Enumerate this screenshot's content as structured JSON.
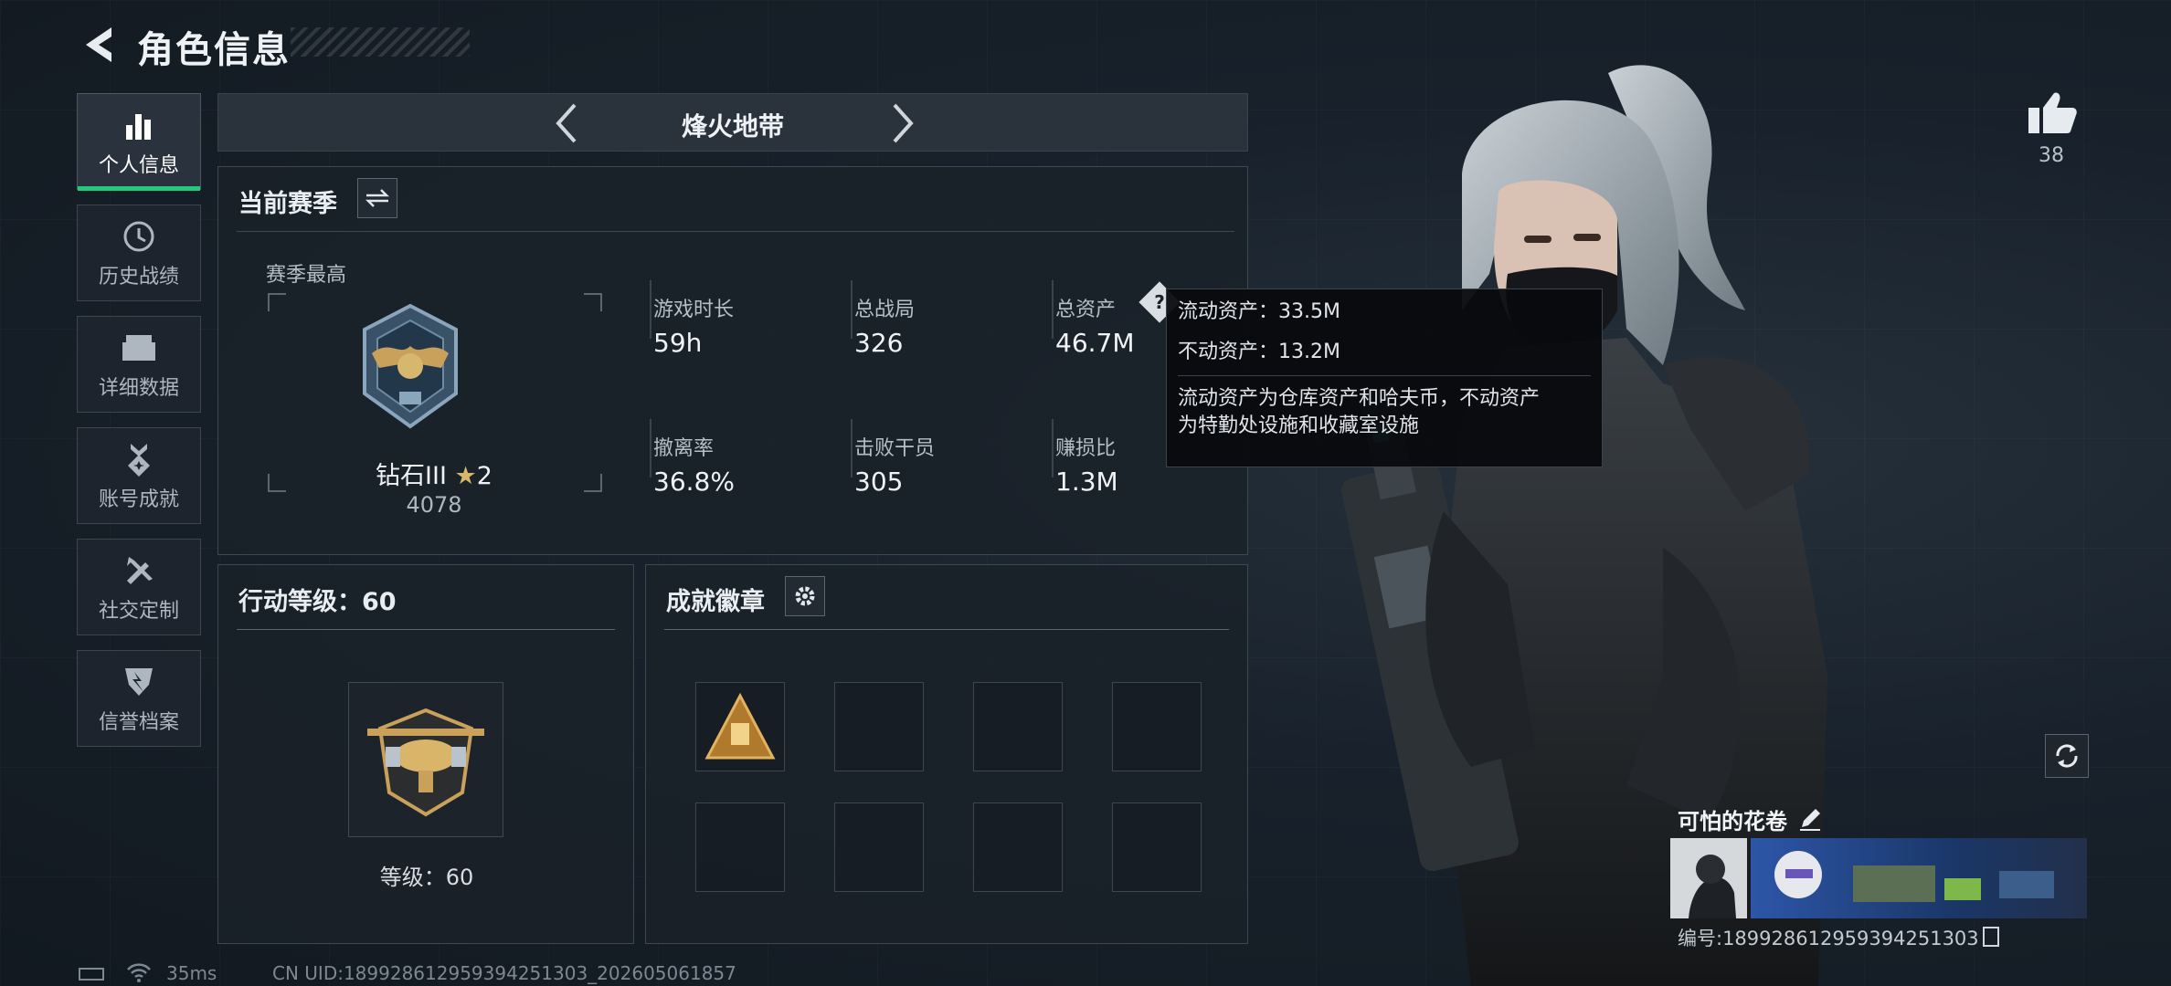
{
  "header": {
    "title": "角色信息"
  },
  "sidebar": {
    "items": [
      {
        "label": "个人信息",
        "icon": "bar-chart-icon",
        "active": true
      },
      {
        "label": "历史战绩",
        "icon": "clock-icon"
      },
      {
        "label": "详细数据",
        "icon": "folder-icon"
      },
      {
        "label": "账号成就",
        "icon": "medal-icon"
      },
      {
        "label": "社交定制",
        "icon": "tools-icon"
      },
      {
        "label": "信誉档案",
        "icon": "shield-icon"
      }
    ]
  },
  "mode": {
    "title": "烽火地带"
  },
  "season": {
    "header": "当前赛季",
    "best_label": "赛季最高",
    "rank_name": "钻石III",
    "rank_stars": "2",
    "rank_score": "4078",
    "stats": [
      {
        "label": "游戏时长",
        "value": "59h"
      },
      {
        "label": "总战局",
        "value": "326"
      },
      {
        "label": "总资产",
        "value": "46.7M"
      },
      {
        "label": "撤离率",
        "value": "36.8%"
      },
      {
        "label": "击败干员",
        "value": "305"
      },
      {
        "label": "赚损比",
        "value": "1.3M"
      }
    ]
  },
  "tooltip": {
    "liquid": "流动资产：33.5M",
    "fixed": "不动资产：13.2M",
    "desc_line1": "流动资产为仓库资产和哈夫币，不动资产",
    "desc_line2": "为特勤处设施和收藏室设施"
  },
  "level": {
    "header": "行动等级：60",
    "level_text": "等级：60"
  },
  "badges": {
    "header": "成就徽章"
  },
  "likes": {
    "count": "38"
  },
  "profile": {
    "name": "可怕的花卷",
    "id_text": "编号:18992861295939425130​3"
  },
  "footer": {
    "ping": "35ms",
    "uid": "CN UID:18992861295939425130​3_202605061857"
  },
  "colors": {
    "accent": "#25c97a",
    "panel_bg": "#1a2129",
    "gold": "#c9a15a"
  }
}
